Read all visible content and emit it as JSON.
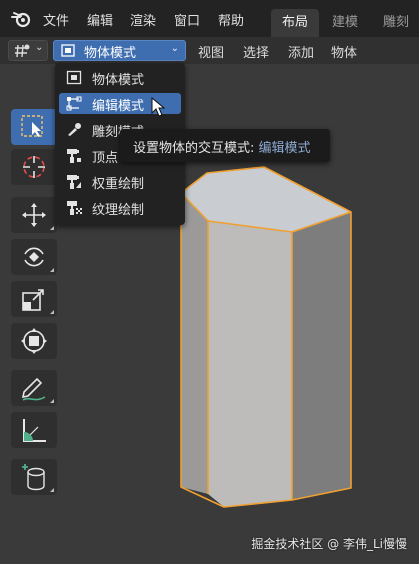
{
  "topbar": {
    "menus": [
      "文件",
      "编辑",
      "渲染",
      "窗口",
      "帮助"
    ],
    "workspace_tabs": [
      {
        "label": "布局",
        "active": true
      },
      {
        "label": "建模",
        "active": false
      },
      {
        "label": "雕刻",
        "active": false
      }
    ]
  },
  "header": {
    "view_type_icon": "editor-type-icon",
    "mode_select": {
      "label": "物体模式",
      "icon": "object-mode-icon"
    },
    "menus": [
      "视图",
      "选择",
      "添加",
      "物体"
    ]
  },
  "dropdown": {
    "items": [
      {
        "label": "物体模式",
        "icon": "object-mode-icon",
        "highlighted": false
      },
      {
        "label": "编辑模式",
        "icon": "edit-mode-icon",
        "highlighted": true
      },
      {
        "label": "雕刻模式",
        "icon": "sculpt-mode-icon",
        "highlighted": false
      },
      {
        "label": "顶点",
        "icon": "vertex-paint-icon",
        "highlighted": false
      },
      {
        "label": "权重绘制",
        "icon": "weight-paint-icon",
        "highlighted": false
      },
      {
        "label": "纹理绘制",
        "icon": "texture-paint-icon",
        "highlighted": false
      }
    ]
  },
  "tooltip": {
    "text": "设置物体的交互模式:",
    "value": "编辑模式"
  },
  "toolbar": {
    "tools": [
      "select-box-icon",
      "cursor-icon",
      "move-icon",
      "rotate-icon",
      "scale-icon",
      "transform-icon",
      "annotate-icon",
      "measure-icon",
      "add-cylinder-icon"
    ]
  },
  "colors": {
    "accent": "#3f6eb0",
    "tooltip_value": "#8ea9d2",
    "object_outline": "#f0a030"
  },
  "watermark": "掘金技术社区 @ 李伟_Li慢慢"
}
